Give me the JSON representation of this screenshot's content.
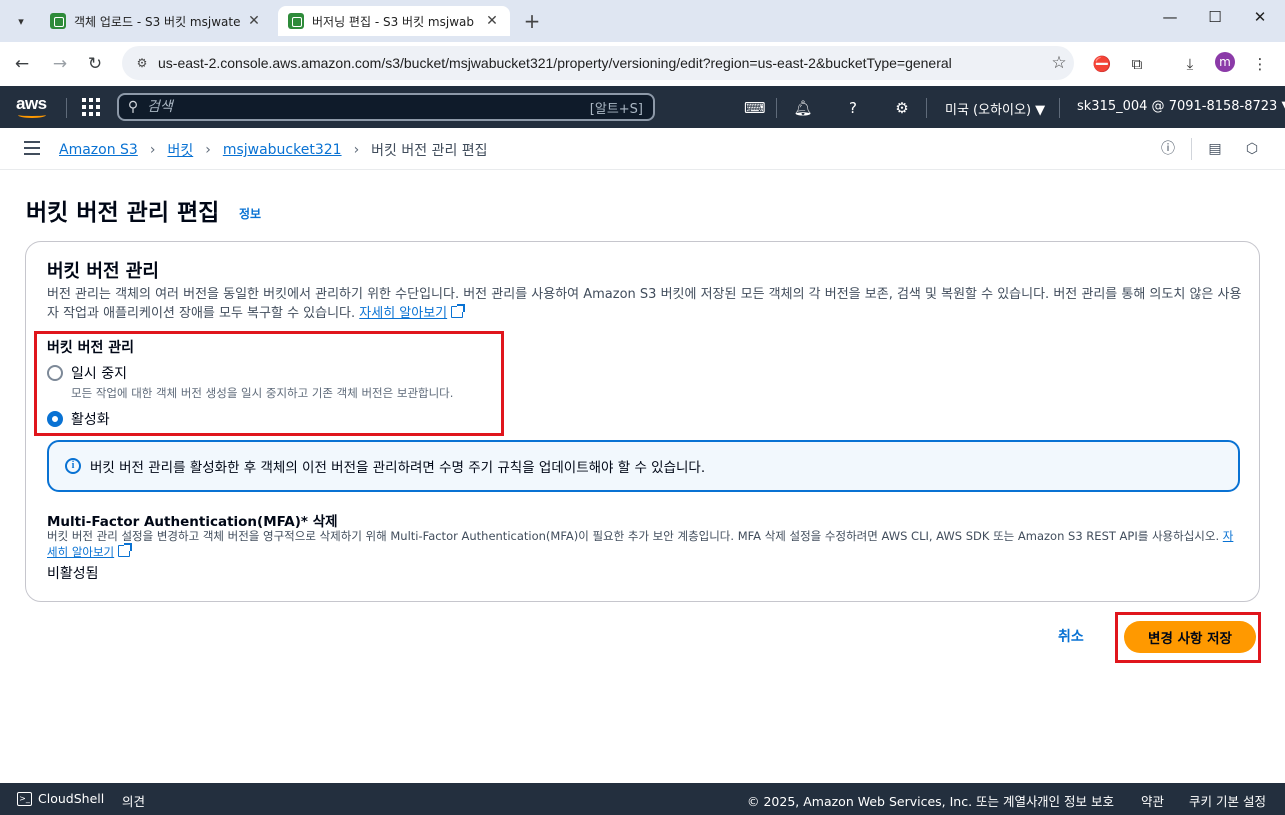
{
  "browser": {
    "tabs": [
      {
        "title": "객체 업로드 - S3 버킷 msjwate"
      },
      {
        "title": "버저닝 편집 - S3 버킷 msjwab"
      }
    ],
    "url": "us-east-2.console.aws.amazon.com/s3/bucket/msjwabucket321/property/versioning/edit?region=us-east-2&bucketType=general",
    "profile_initial": "m"
  },
  "aws_nav": {
    "logo": "aws",
    "search_placeholder": "검색",
    "search_shortcut": "[알트+S]",
    "region": "미국 (오하이오) ▼",
    "account": "sk315_004 @ 7091-8158-8723 ▼"
  },
  "breadcrumb": {
    "items": [
      "Amazon S3",
      "버킷",
      "msjwabucket321"
    ],
    "current": "버킷 버전 관리 편집"
  },
  "page": {
    "title": "버킷 버전 관리 편집",
    "info": "정보"
  },
  "versioning": {
    "title": "버킷 버전 관리",
    "description": "버전 관리는 객체의 여러 버전을 동일한 버킷에서 관리하기 위한 수단입니다. 버전 관리를 사용하여 Amazon S3 버킷에 저장된 모든 객체의 각 버전을 보존, 검색 및 복원할 수 있습니다. 버전 관리를 통해 의도치 않은 사용자 작업과 애플리케이션 장애를 모두 복구할 수 있습니다.",
    "learn_more": "자세히 알아보기",
    "radio_label": "버킷 버전 관리",
    "options": [
      {
        "label": "일시 중지",
        "description": "모든 작업에 대한 객체 버전 생성을 일시 중지하고 기존 객체 버전은 보관합니다.",
        "selected": false
      },
      {
        "label": "활성화",
        "description": "",
        "selected": true
      }
    ],
    "info_alert": "버킷 버전 관리를 활성화한 후 객체의 이전 버전을 관리하려면 수명 주기 규칙을 업데이트해야 할 수 있습니다."
  },
  "mfa": {
    "title": "Multi-Factor Authentication(MFA)* 삭제",
    "description": "버킷 버전 관리 설정을 변경하고 객체 버전을 영구적으로 삭제하기 위해 Multi-Factor Authentication(MFA)이 필요한 추가 보안 계층입니다. MFA 삭제 설정을 수정하려면 AWS CLI, AWS SDK 또는 Amazon S3 REST API를 사용하십시오.",
    "learn_more": "자세히 알아보기",
    "value": "비활성됨"
  },
  "actions": {
    "cancel": "취소",
    "save": "변경 사항 저장"
  },
  "footer": {
    "cloudshell": "CloudShell",
    "feedback": "의견",
    "copyright": "© 2025, Amazon Web Services, Inc. 또는 계열사.",
    "privacy": "개인 정보 보호",
    "terms": "약관",
    "cookies": "쿠키 기본 설정"
  },
  "colors": {
    "aws_nav_bg": "#232f3e",
    "link": "#0972d3",
    "primary_button": "#ff9900",
    "highlight": "#e0151c"
  }
}
